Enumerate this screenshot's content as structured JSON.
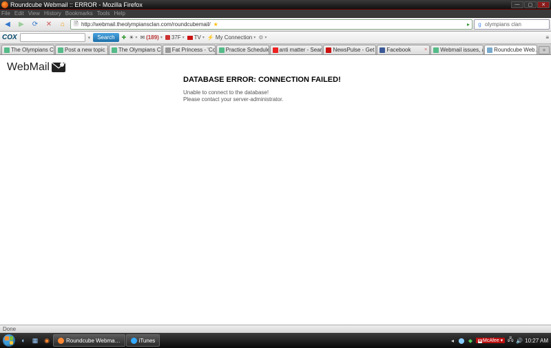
{
  "window": {
    "title": "Roundcube Webmail :: ERROR - Mozilla Firefox"
  },
  "menu": [
    "File",
    "Edit",
    "View",
    "History",
    "Bookmarks",
    "Tools",
    "Help"
  ],
  "nav": {
    "url": "http://webmail.theolympiansclan.com/roundcubemail/",
    "search_value": "olympians clan",
    "search_placeholder": "Google"
  },
  "cox": {
    "brand": "COX",
    "search_btn": "Search",
    "items": [
      {
        "icon": "plus-icon",
        "label": ""
      },
      {
        "icon": "weather-icon",
        "label": ""
      },
      {
        "icon": "mail-icon",
        "label": "(189)"
      },
      {
        "icon": "temp-icon",
        "label": "37F"
      },
      {
        "icon": "tv-icon",
        "label": "TV"
      },
      {
        "icon": "link-icon",
        "label": "My Connection"
      },
      {
        "icon": "gear-icon",
        "label": ""
      }
    ]
  },
  "tabs": [
    {
      "label": "The Olympians Cla…",
      "fav": "#5b8"
    },
    {
      "label": "Post a new topic",
      "fav": "#5b8"
    },
    {
      "label": "The Olympians Clan",
      "fav": "#5b8"
    },
    {
      "label": "Fat Princess - 'Con…",
      "fav": "#999"
    },
    {
      "label": "Practice Schedule",
      "fav": "#5b8"
    },
    {
      "label": "anti matter - Searc…",
      "fav": "#e22"
    },
    {
      "label": "NewsPulse - Get th…",
      "fav": "#c11"
    },
    {
      "label": "Facebook",
      "fav": "#3b5998"
    },
    {
      "label": "Webmail issues, ag…",
      "fav": "#5b8"
    },
    {
      "label": "Roundcube Web… ",
      "fav": "#7ac",
      "active": true
    }
  ],
  "page": {
    "logo_a": "Web",
    "logo_b": "Mail",
    "error_title": "DATABASE ERROR: CONNECTION FAILED!",
    "error_line1": "Unable to connect to the database!",
    "error_line2": "Please contact your server-administrator."
  },
  "status": {
    "text": "Done"
  },
  "taskbar": {
    "apps": [
      {
        "icon": "#ff8833",
        "label": "Roundcube Webma…"
      },
      {
        "icon": "#33aaff",
        "label": "iTunes"
      }
    ],
    "mcafee": "McAfee",
    "time": "10:27 AM"
  }
}
